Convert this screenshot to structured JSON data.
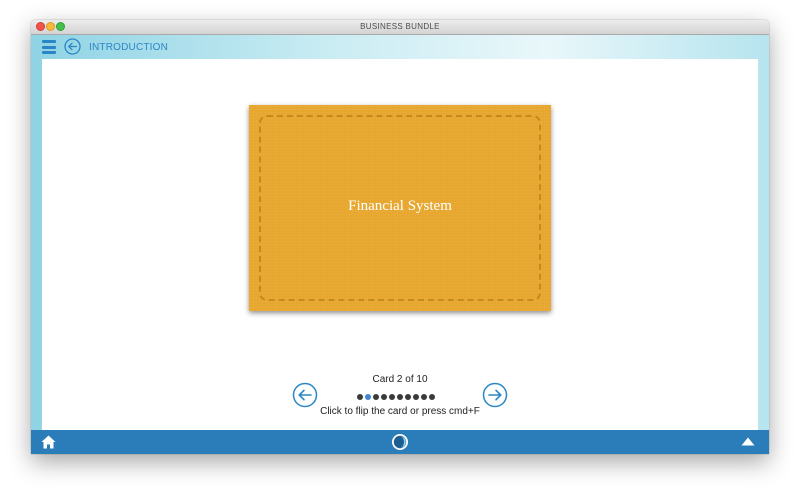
{
  "window": {
    "title": "BUSINESS BUNDLE"
  },
  "header": {
    "title": "INTRODUCTION",
    "menu_icon": "hamburger-icon",
    "back_icon": "back-arrow-icon"
  },
  "card": {
    "text": "Financial System",
    "color": "#e7a72f"
  },
  "pagination": {
    "counter": "Card 2 of 10",
    "current": 2,
    "total": 10,
    "hint": "Click to flip the card  or press cmd+F",
    "active_color": "#3f88d0"
  },
  "bottom_bar": {
    "home_icon": "home-icon",
    "logo_icon": "app-logo-icon",
    "up_icon": "caret-up-icon",
    "color": "#2a7db8"
  },
  "accent": "#2b86c5"
}
